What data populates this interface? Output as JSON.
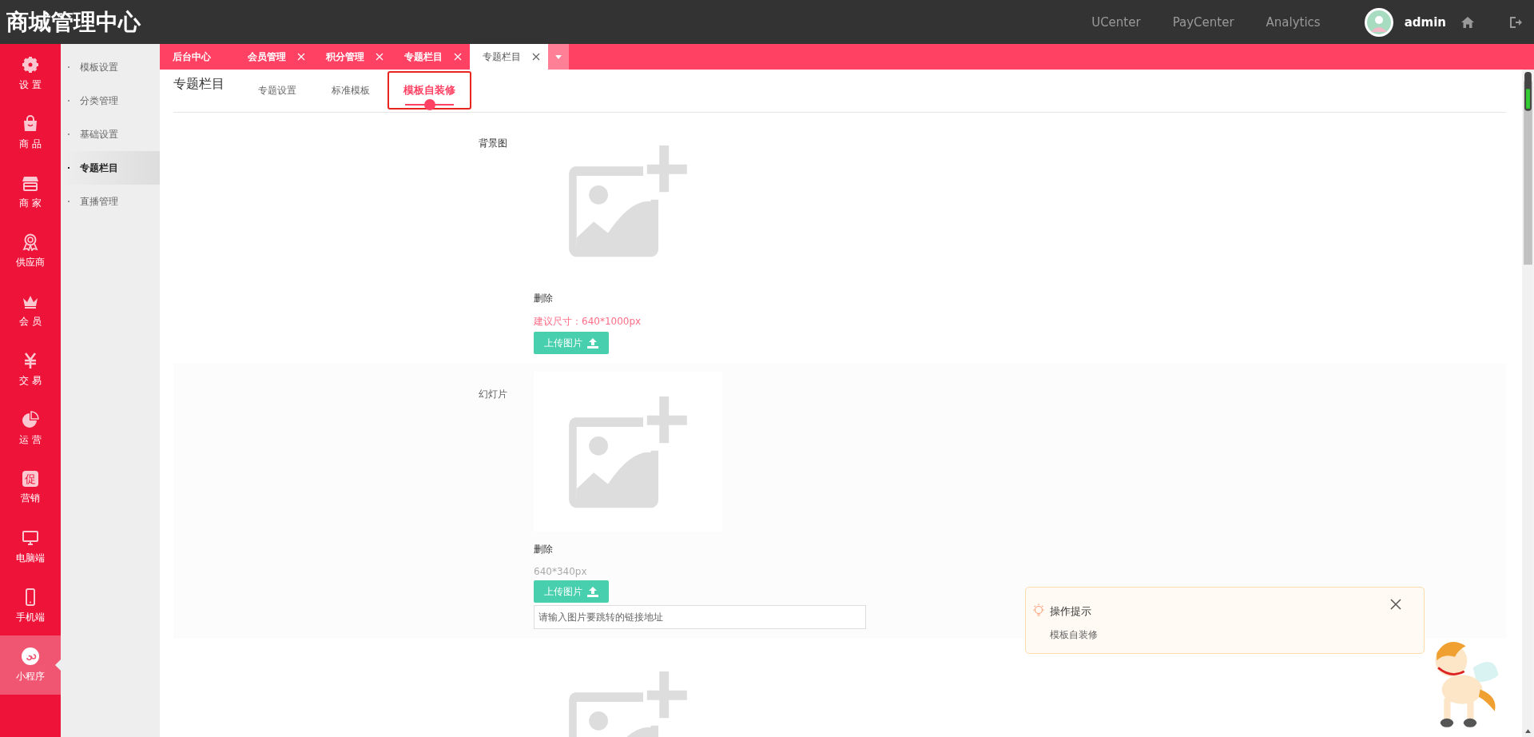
{
  "header": {
    "title": "商城管理中心",
    "links": [
      "UCenter",
      "PayCenter",
      "Analytics"
    ],
    "user": "admin"
  },
  "nav": [
    {
      "label": "设 置",
      "selected": false
    },
    {
      "label": "商 品",
      "selected": false
    },
    {
      "label": "商 家",
      "selected": false
    },
    {
      "label": "供应商",
      "selected": false
    },
    {
      "label": "会 员",
      "selected": false
    },
    {
      "label": "交 易",
      "selected": false
    },
    {
      "label": "运 营",
      "selected": false
    },
    {
      "label": "营销",
      "icon_text": "促",
      "selected": false
    },
    {
      "label": "电脑端",
      "selected": false
    },
    {
      "label": "手机端",
      "selected": false
    },
    {
      "label": "小程序",
      "selected": true
    }
  ],
  "submenu": [
    {
      "label": "模板设置",
      "selected": false
    },
    {
      "label": "分类管理",
      "selected": false
    },
    {
      "label": "基础设置",
      "selected": false
    },
    {
      "label": "专题栏目",
      "selected": true
    },
    {
      "label": "直播管理",
      "selected": false
    }
  ],
  "tabs": [
    {
      "label": "后台中心",
      "closable": false,
      "selected": false
    },
    {
      "label": "会员管理",
      "closable": true,
      "selected": false
    },
    {
      "label": "积分管理",
      "closable": true,
      "selected": false
    },
    {
      "label": "专题栏目",
      "closable": true,
      "selected": false
    },
    {
      "label": "专题栏目",
      "closable": true,
      "selected": true
    }
  ],
  "page": {
    "title": "专题栏目",
    "subtabs": [
      {
        "label": "专题设置",
        "selected": false
      },
      {
        "label": "标准模板",
        "selected": false
      },
      {
        "label": "模板自装修",
        "selected": true
      }
    ]
  },
  "sections": [
    {
      "label": "背景图",
      "delete": "删除",
      "hint": "建议尺寸：640*1000px",
      "kind": "cover",
      "upload": "上传图片"
    },
    {
      "label": "幻灯片",
      "shaded": true,
      "delete": "删除",
      "hint": "640*340px",
      "kind": "slide",
      "upload": "上传图片",
      "link_placeholder": "请输入图片要跳转的链接地址"
    },
    {
      "kind": "image"
    }
  ],
  "tip": {
    "title": "操作提示",
    "text": "模板自装修"
  }
}
